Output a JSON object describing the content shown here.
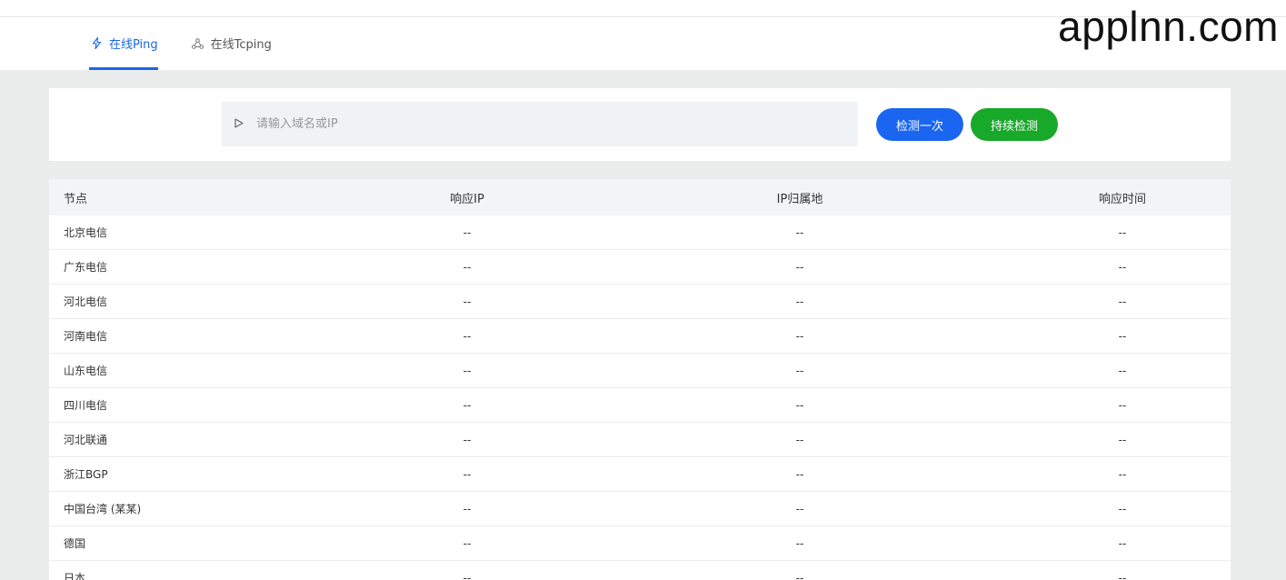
{
  "watermark": "applnn.com",
  "tabs": [
    {
      "label": "在线Ping",
      "icon": "lightning-icon",
      "active": true
    },
    {
      "label": "在线Tcping",
      "icon": "network-icon",
      "active": false
    }
  ],
  "search": {
    "placeholder": "请输入域名或IP",
    "value": ""
  },
  "buttons": {
    "check_once": "检测一次",
    "continuous": "持续检测"
  },
  "colors": {
    "accent": "#1a66f0",
    "continuous": "#18a82a"
  },
  "table": {
    "headers": [
      "节点",
      "响应IP",
      "IP归属地",
      "响应时间"
    ],
    "rows": [
      [
        "北京电信",
        "--",
        "--",
        "--"
      ],
      [
        "广东电信",
        "--",
        "--",
        "--"
      ],
      [
        "河北电信",
        "--",
        "--",
        "--"
      ],
      [
        "河南电信",
        "--",
        "--",
        "--"
      ],
      [
        "山东电信",
        "--",
        "--",
        "--"
      ],
      [
        "四川电信",
        "--",
        "--",
        "--"
      ],
      [
        "河北联通",
        "--",
        "--",
        "--"
      ],
      [
        "浙江BGP",
        "--",
        "--",
        "--"
      ],
      [
        "中国台湾 (某某)",
        "--",
        "--",
        "--"
      ],
      [
        "德国",
        "--",
        "--",
        "--"
      ],
      [
        "日本",
        "--",
        "--",
        "--"
      ]
    ]
  }
}
